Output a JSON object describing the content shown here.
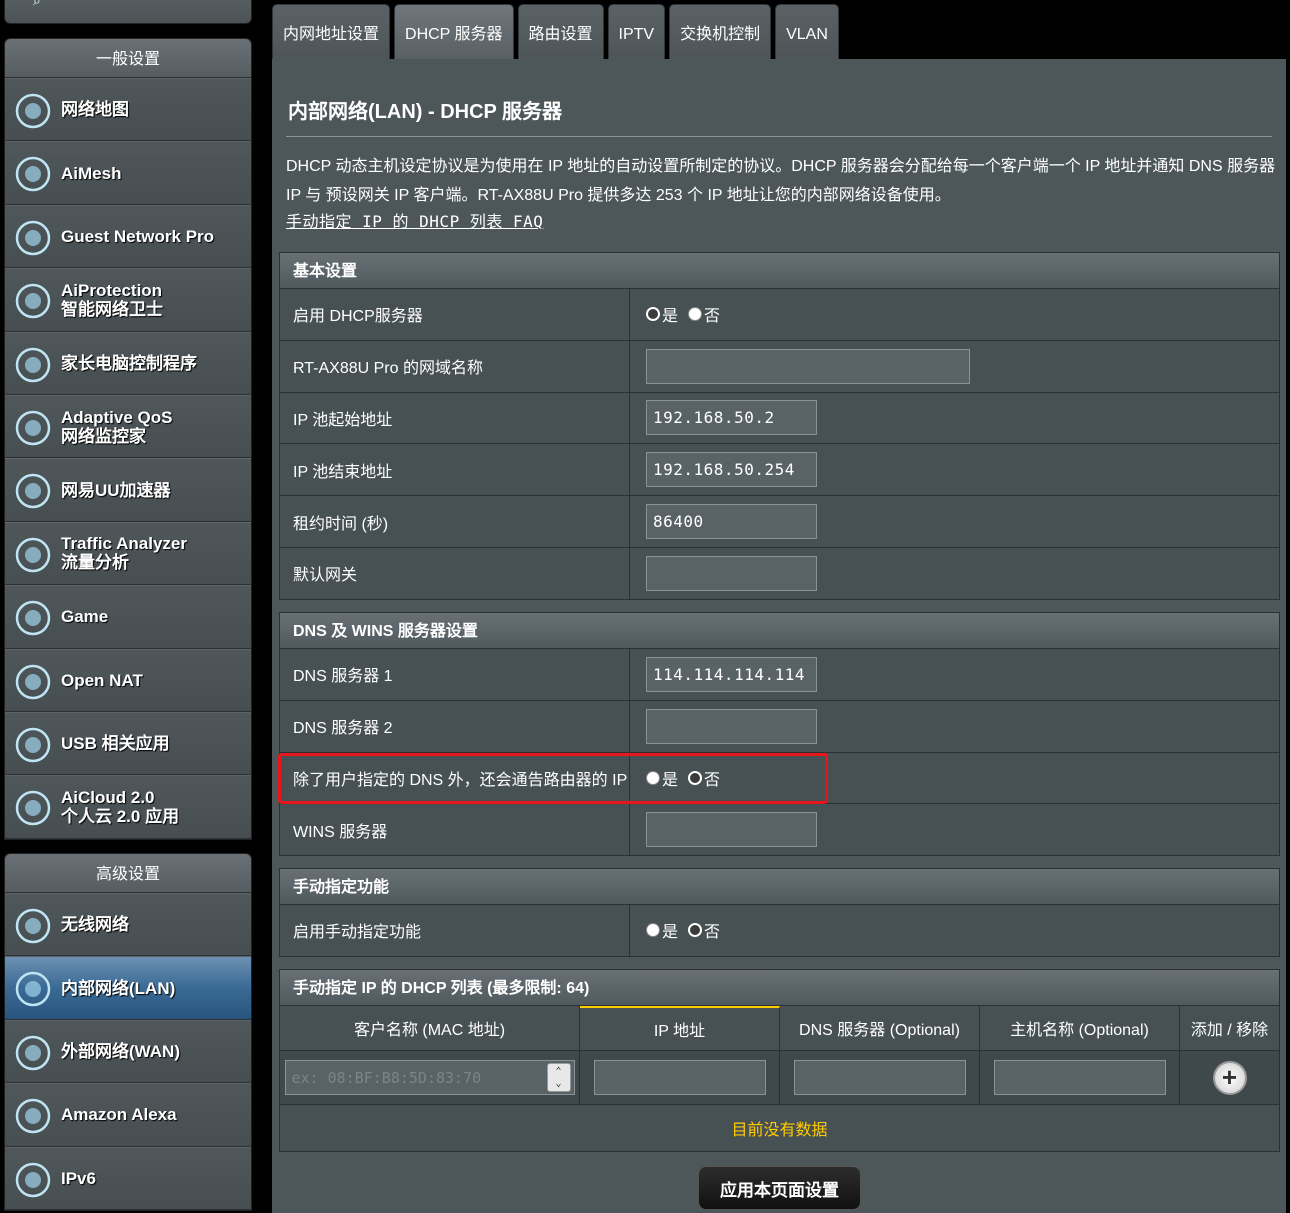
{
  "sidebar": {
    "general_header": "一般设置",
    "general_items": [
      {
        "line1": "网络地图",
        "line2": "",
        "icon": "network-map-icon"
      },
      {
        "line1": "AiMesh",
        "line2": "",
        "icon": "aimesh-icon"
      },
      {
        "line1": "Guest Network Pro",
        "line2": "",
        "icon": "guest-network-icon"
      },
      {
        "line1": "AiProtection",
        "line2": "智能网络卫士",
        "icon": "aiprotection-icon"
      },
      {
        "line1": "家长电脑控制程序",
        "line2": "",
        "icon": "parental-control-icon"
      },
      {
        "line1": "Adaptive QoS",
        "line2": "网络监控家",
        "icon": "qos-gauge-icon"
      },
      {
        "line1": "网易UU加速器",
        "line2": "",
        "icon": "uu-accelerator-icon"
      },
      {
        "line1": "Traffic Analyzer",
        "line2": "流量分析",
        "icon": "traffic-analyzer-icon"
      },
      {
        "line1": "Game",
        "line2": "",
        "icon": "game-controller-icon"
      },
      {
        "line1": "Open NAT",
        "line2": "",
        "icon": "open-nat-icon"
      },
      {
        "line1": "USB 相关应用",
        "line2": "",
        "icon": "usb-icon"
      },
      {
        "line1": "AiCloud 2.0",
        "line2": "个人云 2.0 应用",
        "icon": "aicloud-icon"
      }
    ],
    "advanced_header": "高级设置",
    "advanced_items": [
      {
        "line1": "无线网络",
        "line2": "",
        "icon": "wireless-icon"
      },
      {
        "line1": "内部网络(LAN)",
        "line2": "",
        "icon": "lan-icon",
        "active": true
      },
      {
        "line1": "外部网络(WAN)",
        "line2": "",
        "icon": "wan-globe-icon"
      },
      {
        "line1": "Amazon Alexa",
        "line2": "",
        "icon": "alexa-icon"
      },
      {
        "line1": "IPv6",
        "line2": "",
        "icon": "ipv6-icon"
      }
    ]
  },
  "tabs": [
    "内网地址设置",
    "DHCP 服务器",
    "路由设置",
    "IPTV",
    "交换机控制",
    "VLAN"
  ],
  "active_tab": 1,
  "page": {
    "title": "内部网络(LAN) - DHCP 服务器",
    "description": "DHCP 动态主机设定协议是为使用在 IP 地址的自动设置所制定的协议。DHCP 服务器会分配给每一个客户端一个 IP 地址并通知 DNS 服务器 IP 与 预设网关 IP 客户端。RT-AX88U Pro 提供多达 253 个 IP 地址让您的内部网络设备使用。",
    "faq_link": "手动指定 IP 的 DHCP 列表 FAQ"
  },
  "basic": {
    "header": "基本设置",
    "enable_dhcp_label": "启用 DHCP服务器",
    "yes": "是",
    "no": "否",
    "domain_label": "RT-AX88U Pro 的网域名称",
    "domain_value": "",
    "pool_start_label": "IP 池起始地址",
    "pool_start_value": "192.168.50.2",
    "pool_end_label": "IP 池结束地址",
    "pool_end_value": "192.168.50.254",
    "lease_label": "租约时间 (秒)",
    "lease_value": "86400",
    "gateway_label": "默认网关",
    "gateway_value": ""
  },
  "dns": {
    "header": "DNS 及 WINS 服务器设置",
    "dns1_label": "DNS 服务器 1",
    "dns1_value": "114.114.114.114",
    "dns2_label": "DNS 服务器 2",
    "dns2_value": "",
    "advertise_label": "除了用户指定的 DNS 外，还会通告路由器的 IP",
    "wins_label": "WINS 服务器",
    "wins_value": ""
  },
  "manual": {
    "header": "手动指定功能",
    "enable_label": "启用手动指定功能"
  },
  "dhcp_list": {
    "header": "手动指定 IP 的 DHCP 列表 (最多限制: 64)",
    "columns": [
      "客户名称 (MAC 地址)",
      "IP 地址",
      "DNS 服务器 (Optional)",
      "主机名称 (Optional)",
      "添加 / 移除"
    ],
    "mac_placeholder": "ex: 08:BF:B8:5D:83:70",
    "empty_text": "目前没有数据"
  },
  "apply_button": "应用本页面设置"
}
